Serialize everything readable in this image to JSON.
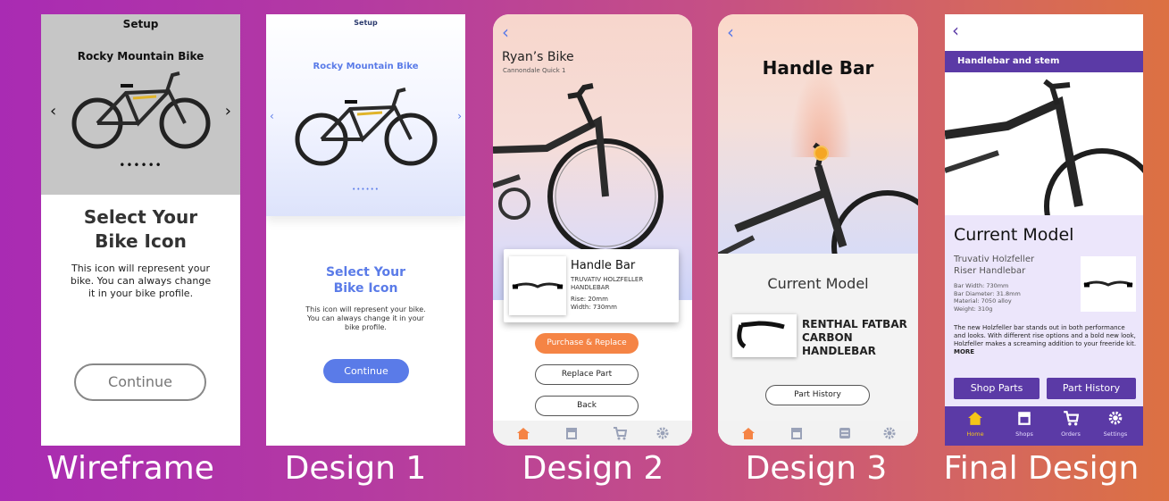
{
  "captions": [
    "Wireframe",
    "Design 1",
    "Design 2",
    "Design 3",
    "Final Design"
  ],
  "wireframe": {
    "setup": "Setup",
    "bike_name": "Rocky Mountain Bike",
    "prev_arrow": "‹",
    "next_arrow": "›",
    "dots": "••••••",
    "title_line1": "Select Your",
    "title_line2": "Bike Icon",
    "description": "This icon will represent your bike. You can always change it in your bike profile.",
    "continue_label": "Continue"
  },
  "design1": {
    "setup": "Setup",
    "bike_name": "Rocky Mountain Bike",
    "prev_arrow": "‹",
    "next_arrow": "›",
    "dots": "••••••",
    "title_line1": "Select Your",
    "title_line2": "Bike Icon",
    "description": "This icon will represent your bike. You can always change it in your bike profile.",
    "continue_label": "Continue",
    "accent": "#5a7be8"
  },
  "design2": {
    "back": "‹",
    "bike_title": "Ryan’s Bike",
    "bike_model": "Cannondale Quick 1",
    "part_name": "Handle Bar",
    "part_brand": "TRUVATIV HOLZFELLER HANDLEBAR",
    "rise": "Rise: 20mm",
    "width": "Width: 730mm",
    "purchase_label": "Purchase & Replace",
    "replace_label": "Replace Part",
    "back_label": "Back",
    "accent": "#f58445",
    "tabs": [
      "home-icon",
      "shop-icon",
      "cart-icon",
      "gear-icon"
    ]
  },
  "design3": {
    "back": "‹",
    "title": "Handle Bar",
    "current_model": "Current Model",
    "part_line1": "RENTHAL FATBAR",
    "part_line2": "CARBON",
    "part_line3": "HANDLEBAR",
    "history_label": "Part History",
    "tabs": [
      "home-icon",
      "shop-icon",
      "list-icon",
      "gear-icon"
    ]
  },
  "final": {
    "back": "‹",
    "section": "Handlebar and stem",
    "current_model": "Current Model",
    "part_line1": "Truvativ Holzfeller",
    "part_line2": "Riser Handlebar",
    "specs": [
      "Bar Width: 730mm",
      "Bar Diameter: 31.8mm",
      "Material: 7050 alloy",
      "Weight: 310g"
    ],
    "description": "The new Holzfeller bar stands out in both performance and looks. With different rise options and a bold new look, Holzfeller makes a screaming addition to your freeride kit.",
    "more": "MORE",
    "shop_parts": "Shop Parts",
    "part_history": "Part History",
    "accent": "#5b3aa6",
    "tabs": [
      {
        "label": "Home",
        "icon": "home-icon"
      },
      {
        "label": "Shops",
        "icon": "shop-icon"
      },
      {
        "label": "Orders",
        "icon": "cart-icon"
      },
      {
        "label": "Settings",
        "icon": "gear-icon"
      }
    ]
  }
}
